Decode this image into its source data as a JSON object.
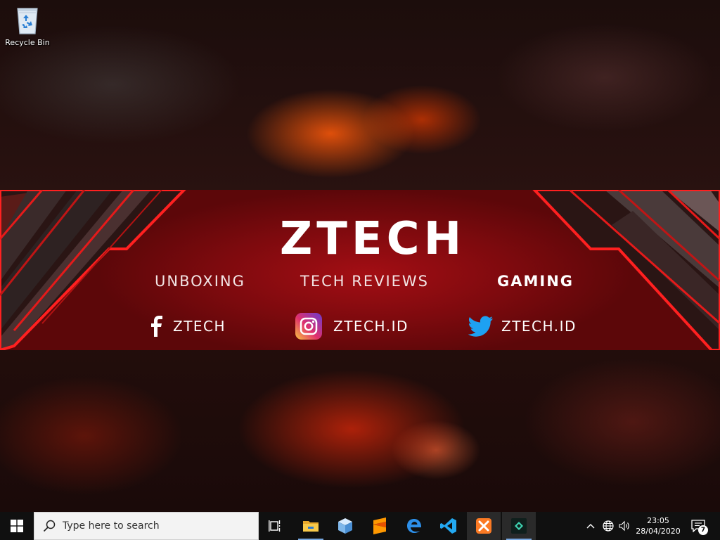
{
  "desktop": {
    "icons": [
      {
        "label": "Recycle Bin",
        "icon": "recycle-bin-icon"
      }
    ],
    "wallpaper": {
      "title": "ZTECH",
      "topics": [
        "UNBOXING",
        "TECH REVIEWS",
        "GAMING"
      ],
      "socials": [
        {
          "platform": "facebook",
          "icon": "facebook-icon",
          "handle": "ZTECH"
        },
        {
          "platform": "instagram",
          "icon": "instagram-icon",
          "handle": "ZTECH.ID"
        },
        {
          "platform": "twitter",
          "icon": "twitter-icon",
          "handle": "ZTECH.ID"
        }
      ],
      "colors": {
        "banner": "#8b0b10",
        "accent": "#e01818",
        "text": "#ffffff"
      }
    }
  },
  "taskbar": {
    "start_icon": "windows-start-icon",
    "search_placeholder": "Type here to search",
    "apps": [
      {
        "name": "Task View",
        "icon": "task-view-icon"
      },
      {
        "name": "File Explorer",
        "icon": "file-explorer-icon"
      },
      {
        "name": "Virtual Box",
        "icon": "cube-app-icon"
      },
      {
        "name": "Sublime Text",
        "icon": "sublime-text-icon"
      },
      {
        "name": "Microsoft Edge",
        "icon": "edge-icon"
      },
      {
        "name": "Visual Studio Code",
        "icon": "vscode-icon"
      },
      {
        "name": "XAMPP",
        "icon": "xampp-icon"
      },
      {
        "name": "Filmora",
        "icon": "filmora-icon"
      }
    ],
    "tray": {
      "time": "23:05",
      "date": "28/04/2020",
      "notification_count": "7"
    }
  }
}
